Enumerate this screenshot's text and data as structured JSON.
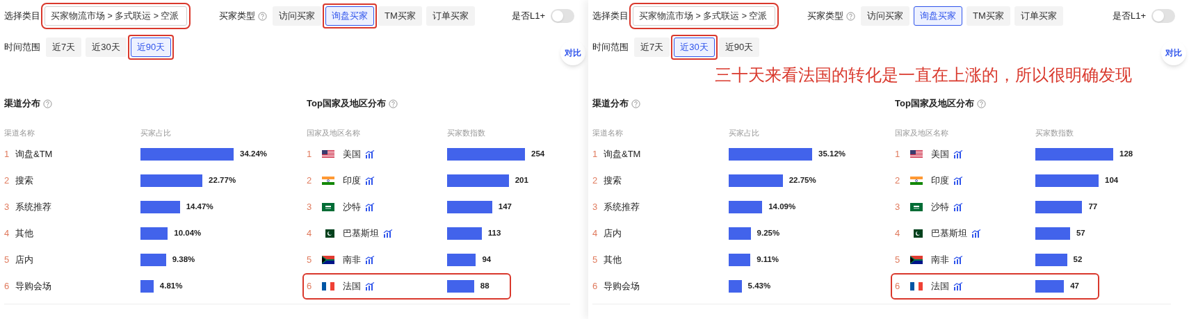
{
  "panels": [
    {
      "category": {
        "label": "选择类目",
        "value": "买家物流市场 > 多式联运 > 空派",
        "highlighted": true
      },
      "buyer_type": {
        "label": "买家类型",
        "tabs": [
          {
            "label": "访问买家",
            "selected": false,
            "highlighted": false
          },
          {
            "label": "询盘买家",
            "selected": true,
            "highlighted": true
          },
          {
            "label": "TM买家",
            "selected": false,
            "highlighted": false
          },
          {
            "label": "订单买家",
            "selected": false,
            "highlighted": false
          }
        ]
      },
      "l1_toggle": {
        "label": "是否L1+",
        "on": false
      },
      "time_range": {
        "label": "时间范围",
        "tabs": [
          {
            "label": "近7天",
            "selected": false,
            "highlighted": false
          },
          {
            "label": "近30天",
            "selected": false,
            "highlighted": false
          },
          {
            "label": "近90天",
            "selected": true,
            "highlighted": true
          }
        ]
      },
      "compare_button": "对比",
      "channels": {
        "title": "渠道分布",
        "columns": [
          "渠道名称",
          "买家占比"
        ],
        "rows": [
          {
            "rank": "1",
            "name": "询盘&TM",
            "value": "34.24%"
          },
          {
            "rank": "2",
            "name": "搜索",
            "value": "22.77%"
          },
          {
            "rank": "3",
            "name": "系统推荐",
            "value": "14.47%"
          },
          {
            "rank": "4",
            "name": "其他",
            "value": "10.04%"
          },
          {
            "rank": "5",
            "name": "店内",
            "value": "9.38%"
          },
          {
            "rank": "6",
            "name": "导购会场",
            "value": "4.81%"
          }
        ]
      },
      "countries": {
        "title": "Top国家及地区分布",
        "columns": [
          "国家及地区名称",
          "买家数指数"
        ],
        "rows": [
          {
            "rank": "1",
            "kind": "us",
            "name": "美国",
            "value": "254",
            "highlighted": false
          },
          {
            "rank": "2",
            "kind": "in",
            "name": "印度",
            "value": "201",
            "highlighted": false
          },
          {
            "rank": "3",
            "kind": "sa",
            "name": "沙特",
            "value": "147",
            "highlighted": false
          },
          {
            "rank": "4",
            "kind": "pk",
            "name": "巴基斯坦",
            "value": "113",
            "highlighted": false
          },
          {
            "rank": "5",
            "kind": "za",
            "name": "南非",
            "value": "94",
            "highlighted": false
          },
          {
            "rank": "6",
            "kind": "fr",
            "name": "法国",
            "value": "88",
            "highlighted": true
          }
        ]
      }
    },
    {
      "category": {
        "label": "选择类目",
        "value": "买家物流市场 > 多式联运 > 空派",
        "highlighted": true
      },
      "buyer_type": {
        "label": "买家类型",
        "tabs": [
          {
            "label": "访问买家",
            "selected": false,
            "highlighted": false
          },
          {
            "label": "询盘买家",
            "selected": true,
            "highlighted": false
          },
          {
            "label": "TM买家",
            "selected": false,
            "highlighted": false
          },
          {
            "label": "订单买家",
            "selected": false,
            "highlighted": false
          }
        ]
      },
      "l1_toggle": {
        "label": "是否L1+",
        "on": false
      },
      "time_range": {
        "label": "时间范围",
        "tabs": [
          {
            "label": "近7天",
            "selected": false,
            "highlighted": false
          },
          {
            "label": "近30天",
            "selected": true,
            "highlighted": true
          },
          {
            "label": "近90天",
            "selected": false,
            "highlighted": false
          }
        ]
      },
      "compare_button": "对比",
      "annotation": "三十天来看法国的转化是一直在上涨的，所以很明确发现",
      "channels": {
        "title": "渠道分布",
        "columns": [
          "渠道名称",
          "买家占比"
        ],
        "rows": [
          {
            "rank": "1",
            "name": "询盘&TM",
            "value": "35.12%"
          },
          {
            "rank": "2",
            "name": "搜索",
            "value": "22.75%"
          },
          {
            "rank": "3",
            "name": "系统推荐",
            "value": "14.09%"
          },
          {
            "rank": "4",
            "name": "店内",
            "value": "9.25%"
          },
          {
            "rank": "5",
            "name": "其他",
            "value": "9.11%"
          },
          {
            "rank": "6",
            "name": "导购会场",
            "value": "5.43%"
          }
        ]
      },
      "countries": {
        "title": "Top国家及地区分布",
        "columns": [
          "国家及地区名称",
          "买家数指数"
        ],
        "rows": [
          {
            "rank": "1",
            "kind": "us",
            "name": "美国",
            "value": "128",
            "highlighted": false
          },
          {
            "rank": "2",
            "kind": "in",
            "name": "印度",
            "value": "104",
            "highlighted": false
          },
          {
            "rank": "3",
            "kind": "sa",
            "name": "沙特",
            "value": "77",
            "highlighted": false
          },
          {
            "rank": "4",
            "kind": "pk",
            "name": "巴基斯坦",
            "value": "57",
            "highlighted": false
          },
          {
            "rank": "5",
            "kind": "za",
            "name": "南非",
            "value": "52",
            "highlighted": false
          },
          {
            "rank": "6",
            "kind": "fr",
            "name": "法国",
            "value": "47",
            "highlighted": true
          }
        ]
      }
    }
  ]
}
